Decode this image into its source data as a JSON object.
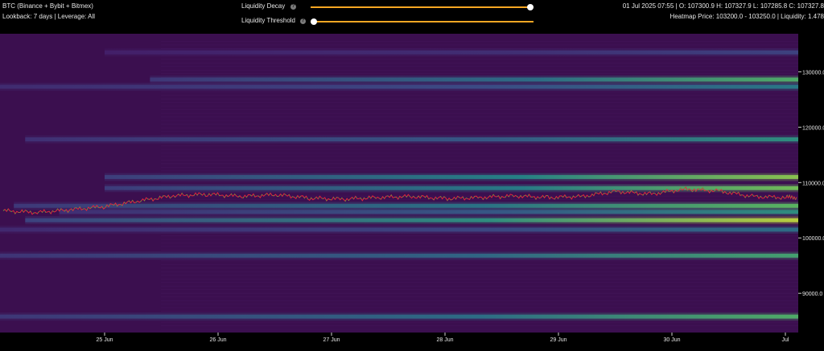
{
  "header": {
    "title": "BTC (Binance + Bybit + Bitmex)",
    "subtitle": "Lookback: 7 days | Leverage: All",
    "ohlc": "01 Jul 2025 07:55 | O: 107300.9 H: 107327.9 L: 107285.8 C: 107327.8",
    "heatmap_info": "Heatmap Price: 103200.0 - 103250.0 | Liquidity: 1.478"
  },
  "controls": {
    "liquidity_decay": {
      "label": "Liquidity Decay",
      "value": 1.0
    },
    "liquidity_threshold": {
      "label": "Liquidity Threshold",
      "value": 0.0
    },
    "info_glyph": "?"
  },
  "colors": {
    "background": "#3b0f4f",
    "slider": "#f5a623",
    "candle_up": "#2ecc40",
    "candle_down": "#e0283c"
  },
  "chart_data": {
    "type": "heatmap",
    "x_labels": [
      "25 Jun",
      "26 Jun",
      "27 Jun",
      "28 Jun",
      "29 Jun",
      "30 Jun",
      "Jul"
    ],
    "y_ticks": [
      90000,
      100000,
      110000,
      120000,
      130000
    ],
    "y_tick_labels": [
      "90000.0",
      "100000.0",
      "110000.0",
      "120000.0",
      "130000.0"
    ],
    "ylim": [
      83500,
      136000
    ],
    "liquidity_bands": [
      {
        "price": 85800,
        "start_day": 0.0,
        "intensity": 0.75
      },
      {
        "price": 96800,
        "start_day": 0.0,
        "intensity": 0.7
      },
      {
        "price": 101500,
        "start_day": 0.0,
        "intensity": 0.45
      },
      {
        "price": 103200,
        "start_day": 0.3,
        "intensity": 1.0
      },
      {
        "price": 104700,
        "start_day": 0.6,
        "intensity": 0.6
      },
      {
        "price": 105800,
        "start_day": 0.2,
        "intensity": 0.8
      },
      {
        "price": 109000,
        "start_day": 1.0,
        "intensity": 0.85
      },
      {
        "price": 111000,
        "start_day": 1.0,
        "intensity": 0.9
      },
      {
        "price": 117800,
        "start_day": 0.3,
        "intensity": 0.6
      },
      {
        "price": 127300,
        "start_day": 0.0,
        "intensity": 0.5
      },
      {
        "price": 128600,
        "start_day": 1.4,
        "intensity": 0.75
      },
      {
        "price": 133500,
        "start_day": 1.0,
        "intensity": 0.25
      }
    ],
    "price_path": [
      [
        0.0,
        104900
      ],
      [
        0.3,
        104600
      ],
      [
        0.6,
        105100
      ],
      [
        0.9,
        105700
      ],
      [
        1.2,
        106700
      ],
      [
        1.5,
        107600
      ],
      [
        1.8,
        107900
      ],
      [
        2.1,
        107500
      ],
      [
        2.4,
        107800
      ],
      [
        2.7,
        107200
      ],
      [
        3.0,
        107000
      ],
      [
        3.3,
        107300
      ],
      [
        3.6,
        107500
      ],
      [
        3.9,
        107100
      ],
      [
        4.2,
        107300
      ],
      [
        4.5,
        107600
      ],
      [
        4.8,
        107300
      ],
      [
        5.1,
        107500
      ],
      [
        5.4,
        108400
      ],
      [
        5.7,
        107900
      ],
      [
        6.0,
        108800
      ],
      [
        6.3,
        108500
      ],
      [
        6.6,
        107500
      ],
      [
        6.9,
        107300
      ],
      [
        7.0,
        107300
      ]
    ]
  }
}
